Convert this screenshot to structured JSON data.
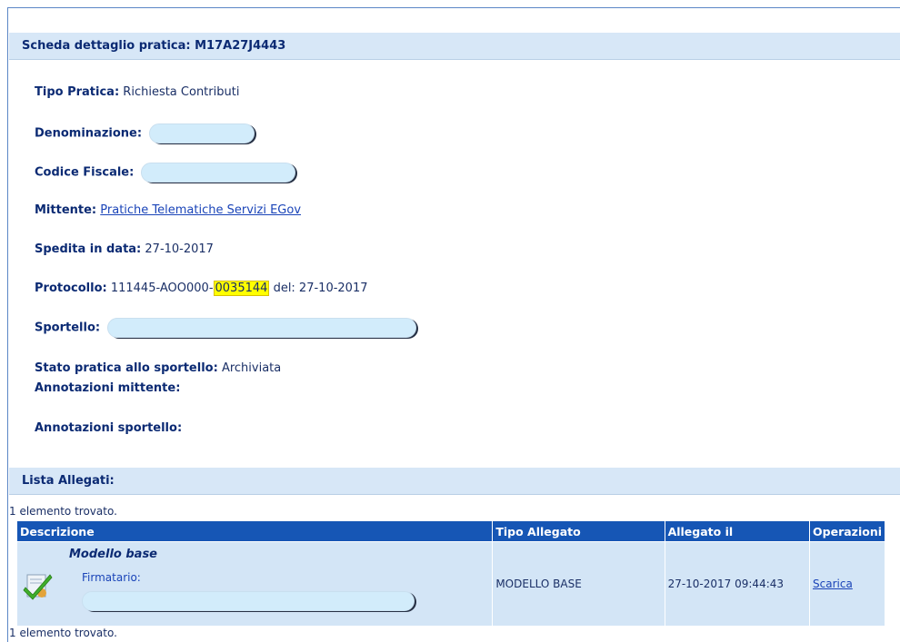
{
  "header": {
    "title": "Scheda dettaglio pratica: M17A27J4443"
  },
  "fields": {
    "tipo_label": "Tipo Pratica:",
    "tipo_value": "Richiesta Contributi",
    "denominazione_label": "Denominazione:",
    "codice_label": "Codice Fiscale:",
    "mittente_label": "Mittente:",
    "mittente_value": "Pratiche Telematiche Servizi EGov",
    "spedita_label": "Spedita in data:",
    "spedita_value": "27-10-2017",
    "protocollo_label": "Protocollo:",
    "protocollo_prefix": "111445-AOO000-",
    "protocollo_number": "0035144",
    "protocollo_del": "del: 27-10-2017",
    "sportello_label": "Sportello:",
    "stato_label": "Stato pratica allo sportello:",
    "stato_value": "Archiviata",
    "annot_mittente_label": "Annotazioni mittente:",
    "annot_sportello_label": "Annotazioni sportello:"
  },
  "allegati": {
    "title": "Lista Allegati:",
    "count_text": "1 elemento trovato.",
    "columns": [
      "Descrizione",
      "Tipo Allegato",
      "Allegato il",
      "Operazioni"
    ],
    "rows": [
      {
        "title": "Modello base",
        "firmatario_label": "Firmatario:",
        "tipo": "MODELLO BASE",
        "data": "27-10-2017 09:44:43",
        "azione": "Scarica"
      }
    ]
  },
  "icons": {
    "attachment": "signed-document-check-icon"
  },
  "colors": {
    "section_bg": "#d7e7f7",
    "table_header": "#1656b5",
    "highlight": "#ffff00"
  }
}
